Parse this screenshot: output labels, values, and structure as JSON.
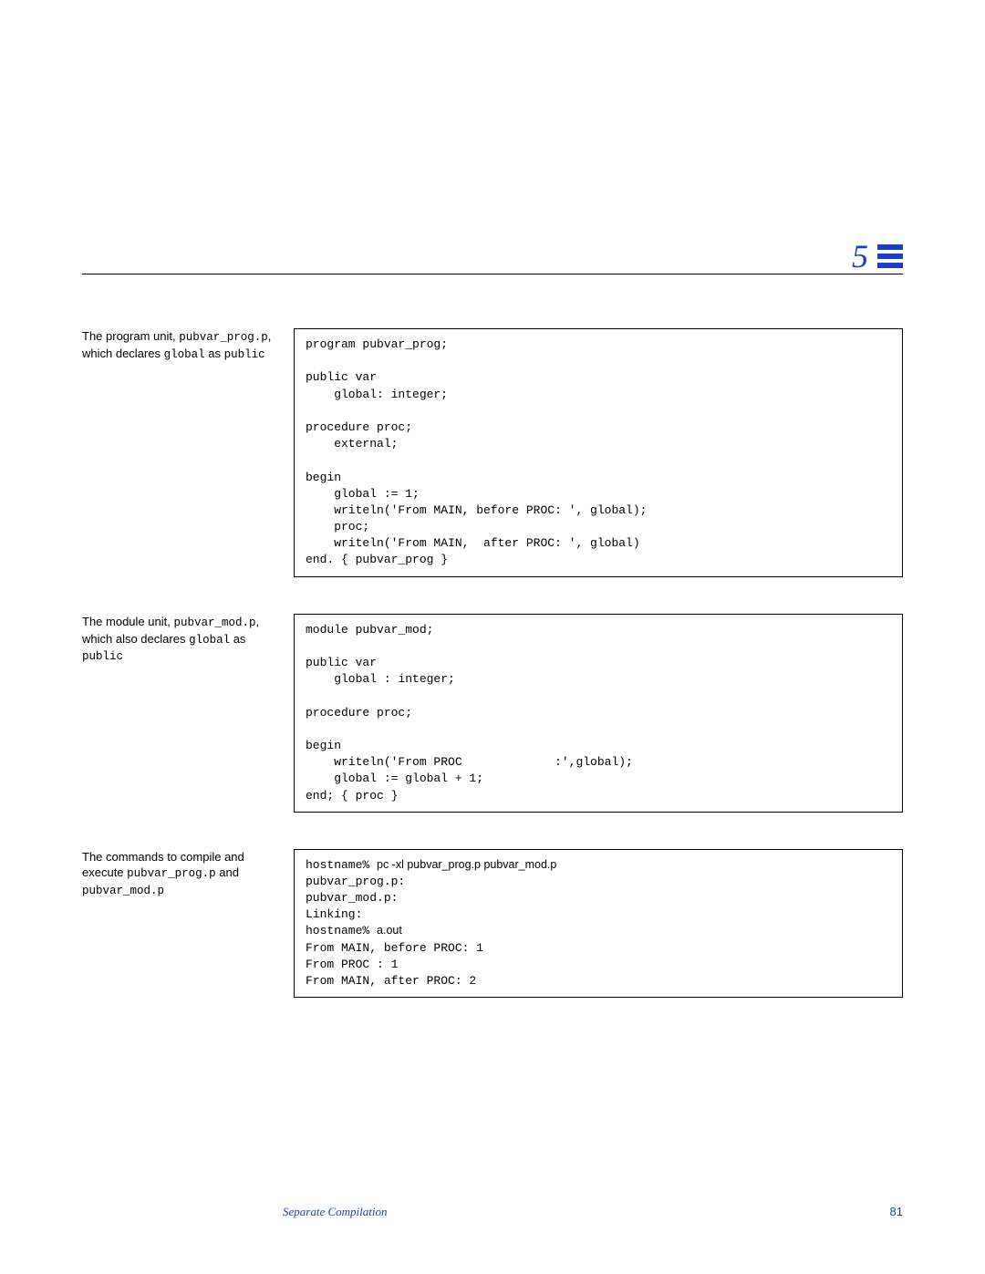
{
  "chapter": "5",
  "blocks": [
    {
      "desc": [
        {
          "t": "The program unit, ",
          "c": ""
        },
        {
          "t": "pubvar_prog.p",
          "c": "mono"
        },
        {
          "t": ", which declares ",
          "c": ""
        },
        {
          "t": "global",
          "c": "mono"
        },
        {
          "t": " as ",
          "c": ""
        },
        {
          "t": "public",
          "c": "mono"
        }
      ],
      "code": "program pubvar_prog;\n\npublic var\n    global: integer;\n\nprocedure proc;\n    external;\n\nbegin\n    global := 1;\n    writeln('From MAIN, before PROC: ', global);\n    proc;\n    writeln('From MAIN,  after PROC: ', global)\nend. { pubvar_prog }"
    },
    {
      "desc": [
        {
          "t": "The module unit, ",
          "c": ""
        },
        {
          "t": "pubvar_mod.p",
          "c": "mono"
        },
        {
          "t": ", which also declares ",
          "c": ""
        },
        {
          "t": "global",
          "c": "mono"
        },
        {
          "t": " as ",
          "c": ""
        },
        {
          "t": "public",
          "c": "mono"
        }
      ],
      "code": "module pubvar_mod;\n\npublic var\n    global : integer;\n\nprocedure proc;\n\nbegin\n    writeln('From PROC             :',global);\n    global := global + 1;\nend; { proc }"
    },
    {
      "desc": [
        {
          "t": "The commands to compile and execute ",
          "c": ""
        },
        {
          "t": "pubvar_prog.p",
          "c": "mono"
        },
        {
          "t": " and ",
          "c": ""
        },
        {
          "t": "pubvar_mod.p",
          "c": "mono"
        }
      ],
      "codeMixed": [
        {
          "t": "hostname% ",
          "c": ""
        },
        {
          "t": "pc -xl pubvar_prog.p pubvar_mod.p",
          "c": "sans"
        },
        {
          "t": "\npubvar_prog.p:\npubvar_mod.p:\nLinking:\nhostname% ",
          "c": ""
        },
        {
          "t": "a.out",
          "c": "sans"
        },
        {
          "t": "\nFrom MAIN, before PROC: 1\nFrom PROC : 1\nFrom MAIN, after PROC: 2",
          "c": ""
        }
      ]
    }
  ],
  "footer": {
    "title": "Separate Compilation",
    "page": "81"
  }
}
